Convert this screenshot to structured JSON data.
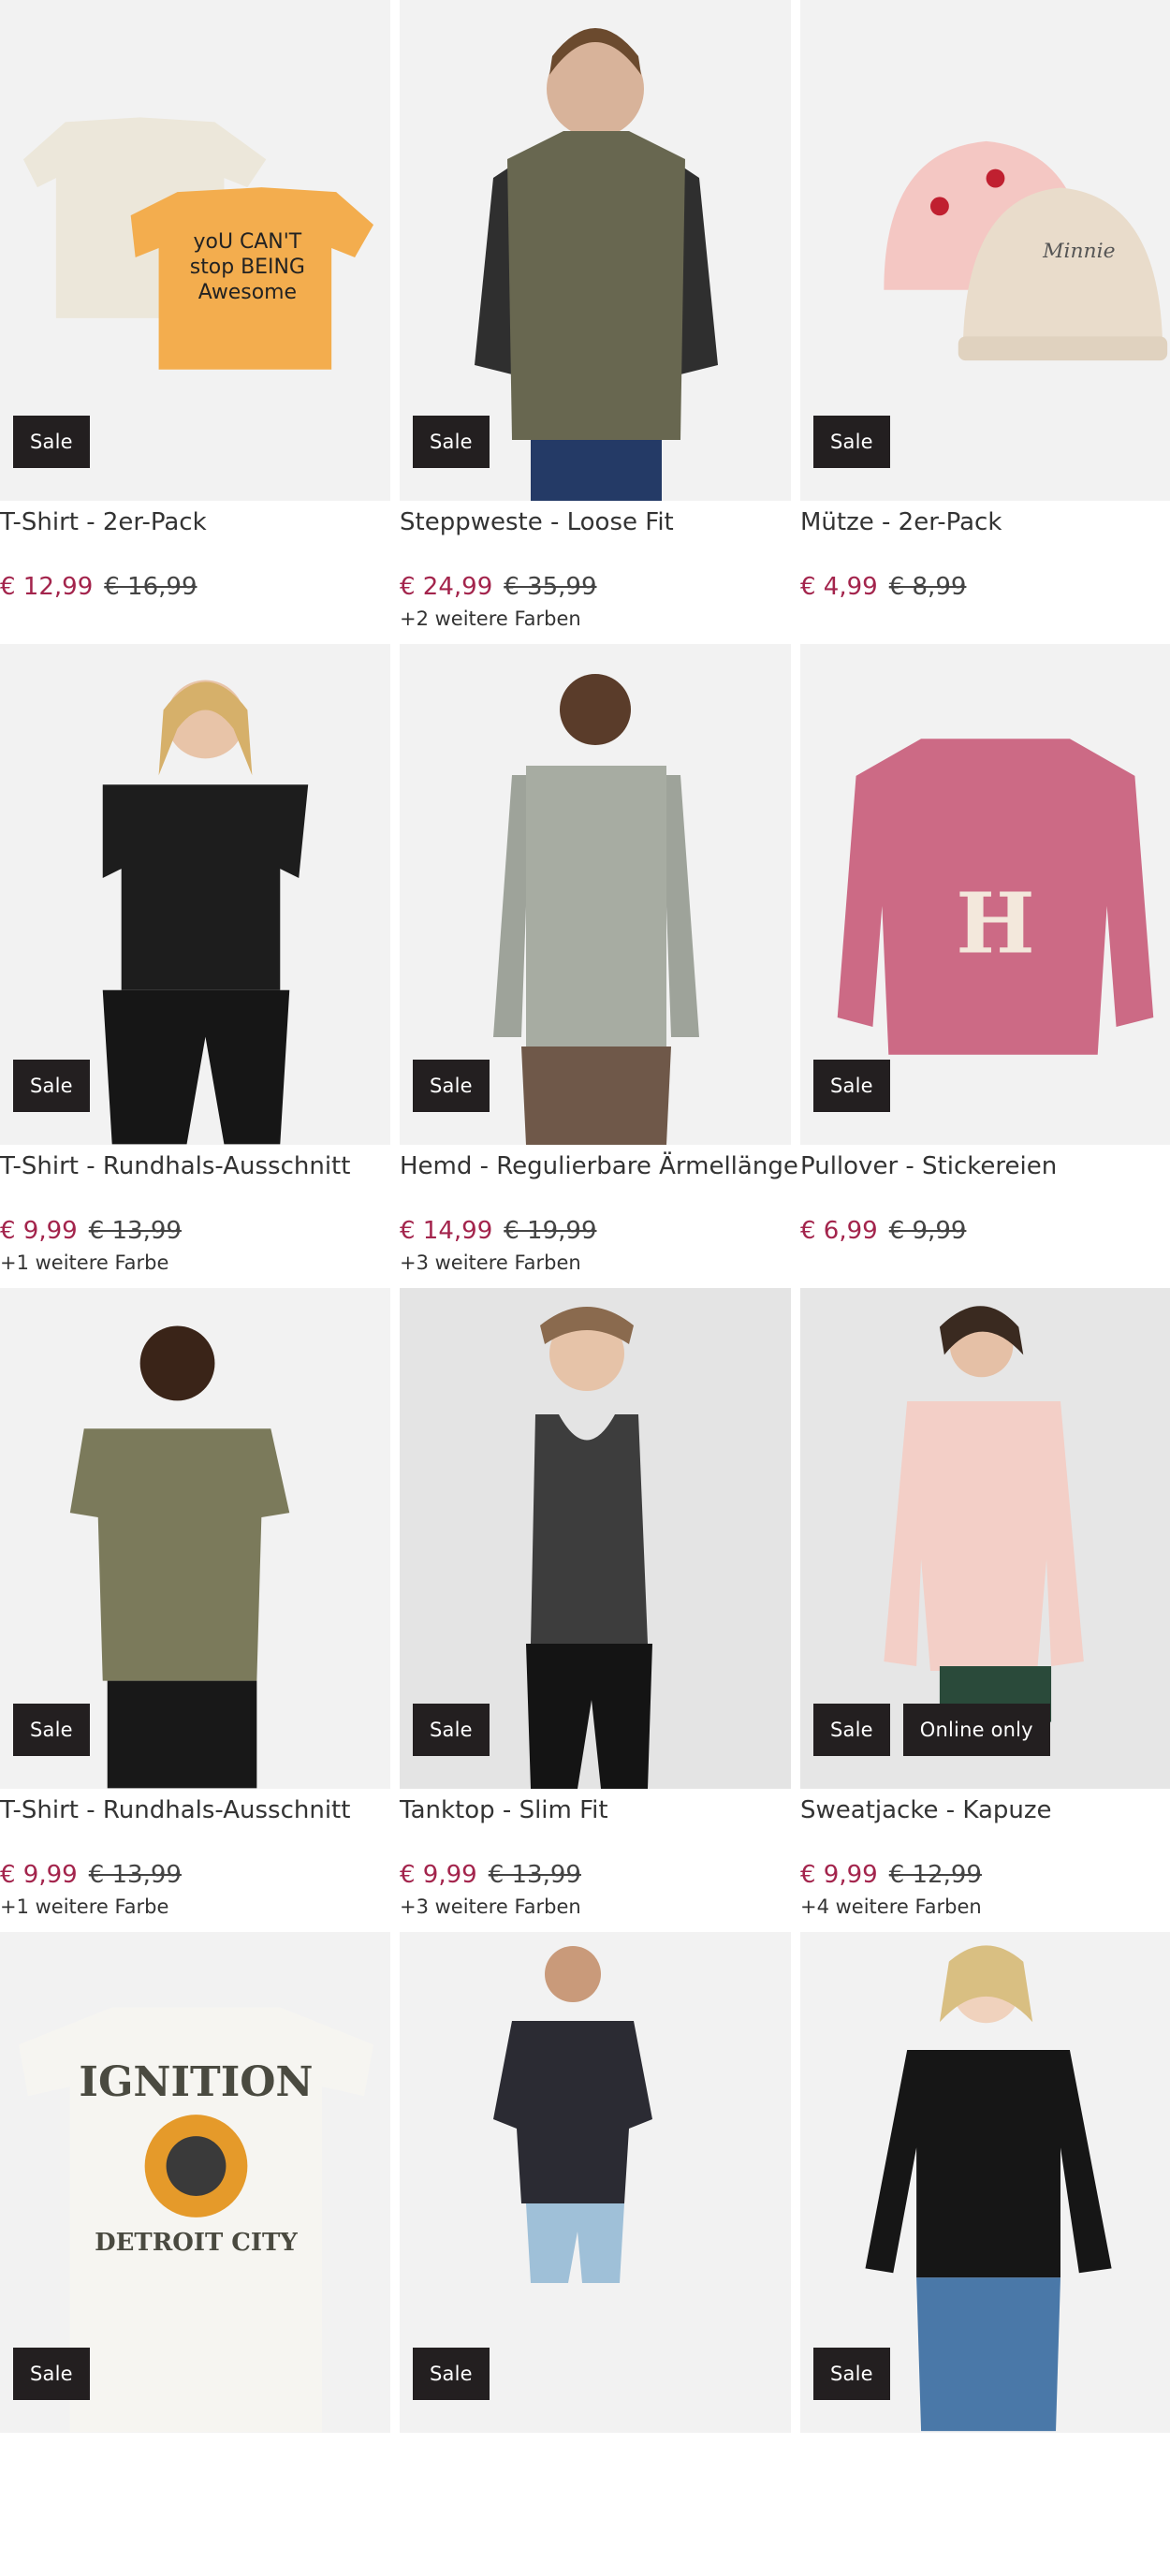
{
  "products": [
    {
      "title": "T-Shirt - 2er-Pack",
      "price_new": "€ 12,99",
      "price_old": "€ 16,99",
      "colors": "",
      "badges": [
        "Sale"
      ],
      "bg": "#f2f2f2",
      "art": "tshirts"
    },
    {
      "title": "Steppweste - Loose Fit",
      "price_new": "€ 24,99",
      "price_old": "€ 35,99",
      "colors": "+2 weitere Farben",
      "badges": [
        "Sale"
      ],
      "bg": "#f2f2f2",
      "art": "vest"
    },
    {
      "title": "Mütze - 2er-Pack",
      "price_new": "€ 4,99",
      "price_old": "€ 8,99",
      "colors": "",
      "badges": [
        "Sale"
      ],
      "bg": "#f2f2f2",
      "art": "hats"
    },
    {
      "title": "T-Shirt - Rundhals-Ausschnitt",
      "price_new": "€ 9,99",
      "price_old": "€ 13,99",
      "colors": "+1 weitere Farbe",
      "badges": [
        "Sale"
      ],
      "bg": "#f2f2f2",
      "art": "woman-black"
    },
    {
      "title": "Hemd - Regulierbare Ärmellänge",
      "price_new": "€ 14,99",
      "price_old": "€ 19,99",
      "colors": "+3 weitere Farben",
      "badges": [
        "Sale"
      ],
      "bg": "#f2f2f2",
      "art": "shirt"
    },
    {
      "title": "Pullover - Stickereien",
      "price_new": "€ 6,99",
      "price_old": "€ 9,99",
      "colors": "",
      "badges": [
        "Sale"
      ],
      "bg": "#f2f2f2",
      "art": "pullover"
    },
    {
      "title": "T-Shirt - Rundhals-Ausschnitt",
      "price_new": "€ 9,99",
      "price_old": "€ 13,99",
      "colors": "+1 weitere Farbe",
      "badges": [
        "Sale"
      ],
      "bg": "#f2f2f2",
      "art": "man-olive"
    },
    {
      "title": "Tanktop - Slim Fit",
      "price_new": "€ 9,99",
      "price_old": "€ 13,99",
      "colors": "+3 weitere Farben",
      "badges": [
        "Sale"
      ],
      "bg": "#e4e4e4",
      "art": "tanktop"
    },
    {
      "title": "Sweatjacke - Kapuze",
      "price_new": "€ 9,99",
      "price_old": "€ 12,99",
      "colors": "+4 weitere Farben",
      "badges": [
        "Sale",
        "Online only"
      ],
      "bg": "#e6e6e6",
      "art": "hoodie"
    },
    {
      "title": "",
      "price_new": "",
      "price_old": "",
      "colors": "",
      "badges": [
        "Sale"
      ],
      "bg": "#f2f2f2",
      "art": "ignition"
    },
    {
      "title": "",
      "price_new": "",
      "price_old": "",
      "colors": "",
      "badges": [
        "Sale"
      ],
      "bg": "#f2f2f2",
      "art": "bandana"
    },
    {
      "title": "",
      "price_new": "",
      "price_old": "",
      "colors": "",
      "badges": [
        "Sale"
      ],
      "bg": "#f2f2f2",
      "art": "longsleeve"
    }
  ],
  "artwork_text": {
    "tshirt_print": [
      "yoU CAN'T",
      "stop BEING",
      "Awesome"
    ],
    "hat_print": "Minnie",
    "pullover_letter": "H",
    "ignition_top": "IGNITION",
    "ignition_bottom": "DETROIT CITY"
  }
}
